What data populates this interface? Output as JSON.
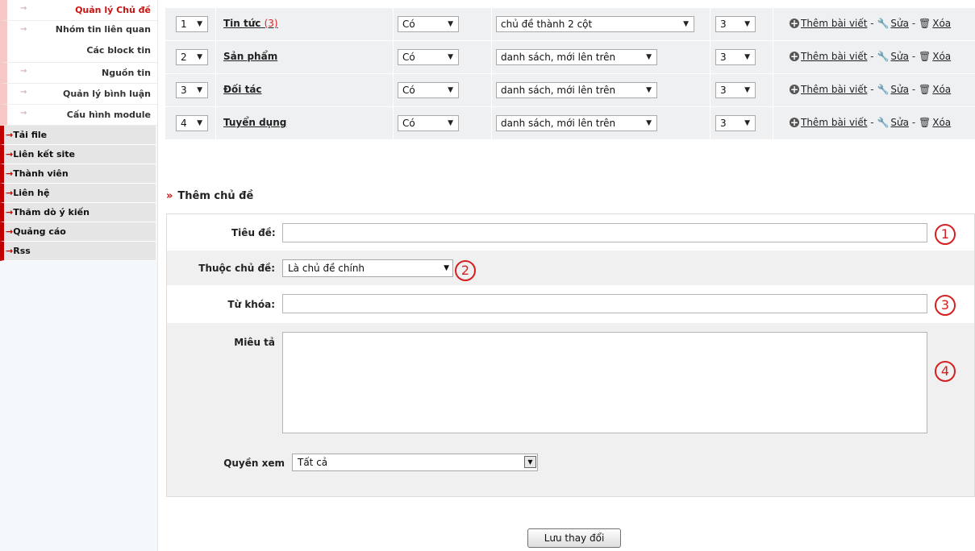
{
  "sidebar": {
    "sub_items": [
      {
        "label": "Quản lý Chủ đề"
      },
      {
        "label_line1": "Nhóm tin liên quan",
        "label_line2": "Các block tin"
      },
      {
        "label": "Nguồn tin"
      },
      {
        "label": "Quản lý bình luận"
      },
      {
        "label": "Cấu hình module"
      }
    ],
    "main_items": [
      {
        "label": "Tải file"
      },
      {
        "label": "Liên kết site"
      },
      {
        "label": "Thành viên"
      },
      {
        "label": "Liên hệ"
      },
      {
        "label": "Thăm dò ý kiến"
      },
      {
        "label": "Quảng cáo"
      },
      {
        "label": "Rss"
      }
    ]
  },
  "topics": [
    {
      "order": "1",
      "name": "Tin tức",
      "count": "(3)",
      "show": "Có",
      "view": "chủ đề thành 2 cột",
      "num": "3"
    },
    {
      "order": "2",
      "name": "Sản phẩm",
      "count": "",
      "show": "Có",
      "view": "danh sách, mới lên trên",
      "num": "3"
    },
    {
      "order": "3",
      "name": "Đối tác",
      "count": "",
      "show": "Có",
      "view": "danh sách, mới lên trên",
      "num": "3"
    },
    {
      "order": "4",
      "name": "Tuyển dụng",
      "count": "",
      "show": "Có",
      "view": "danh sách, mới lên trên",
      "num": "3"
    }
  ],
  "actions": {
    "add_post": "Thêm bài viết",
    "sep": "-",
    "edit": "Sửa",
    "delete": "Xóa"
  },
  "form": {
    "heading": "Thêm chủ đề",
    "title_label": "Tiêu đề:",
    "title_value": "",
    "parent_label": "Thuộc chủ đề:",
    "parent_value": "Là chủ đề chính",
    "keywords_label": "Từ khóa:",
    "keywords_value": "",
    "description_label": "Miêu tả",
    "description_value": "",
    "view_perm_label": "Quyền xem",
    "view_perm_value": "Tất cả",
    "markers": [
      "1",
      "2",
      "3",
      "4"
    ]
  },
  "save_button": "Lưu thay đổi",
  "icons": {
    "arrow": "→",
    "caret": "▼",
    "raquo": "»",
    "plus": "+",
    "wrench": "🔧",
    "trash": "🗑"
  },
  "colors": {
    "accent_red": "#cc1111",
    "sidebar_bar": "#c00000",
    "row_bg": "#eef0f2"
  }
}
